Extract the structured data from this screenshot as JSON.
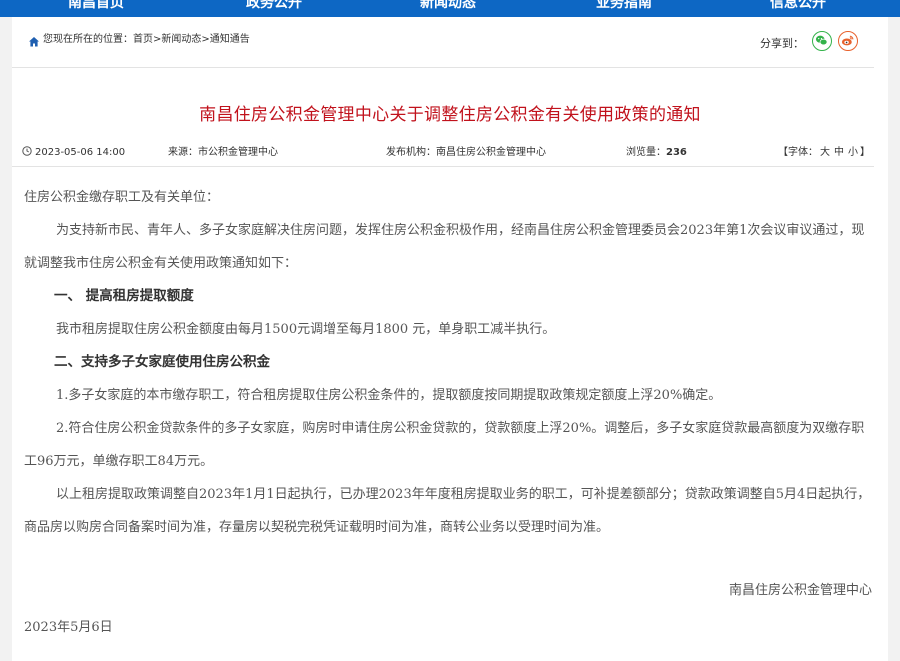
{
  "nav": {
    "items": [
      "南昌首页",
      "政务公开",
      "新闻动态",
      "业务指南",
      "信息公开"
    ]
  },
  "breadcrumb": {
    "prefix": "您现在所在的位置：",
    "home": "首页",
    "sep1": ">",
    "news": "新闻动态",
    "sep2": ">",
    "current": "通知通告"
  },
  "share": {
    "label": "分享到："
  },
  "article": {
    "title": "南昌住房公积金管理中心关于调整住房公积金有关使用政策的通知",
    "datetime": "2023-05-06 14:00",
    "source_label": "来源：",
    "source": "市公积金管理中心",
    "publisher_label": "发布机构：",
    "publisher": "南昌住房公积金管理中心",
    "views_label": "浏览量：",
    "views": "236",
    "fontsize_open": "【字体：",
    "fontsize_large": "大",
    "fontsize_medium": "中",
    "fontsize_small": "小",
    "fontsize_close": "】",
    "salutation": "住房公积金缴存职工及有关单位：",
    "intro": "为支持新市民、青年人、多子女家庭解决住房问题，发挥住房公积金积极作用，经南昌住房公积金管理委员会2023年第1次会议审议通过，现就调整我市住房公积金有关使用政策通知如下：",
    "heading1": "一、  提高租房提取额度",
    "para1": "我市租房提取住房公积金额度由每月1500元调增至每月1800  元，单身职工减半执行。",
    "heading2": "二、支持多子女家庭使用住房公积金",
    "item1": "1.多子女家庭的本市缴存职工，符合租房提取住房公积金条件的，提取额度按同期提取政策规定额度上浮20%确定。",
    "item2": "2.符合住房公积金贷款条件的多子女家庭，购房时申请住房公积金贷款的，贷款额度上浮20%。调整后，多子女家庭贷款最高额度为双缴存职工96万元，单缴存职工84万元。",
    "para_final": "以上租房提取政策调整自2023年1月1日起执行，已办理2023年年度租房提取业务的职工，可补提差额部分；贷款政策调整自5月4日起执行，商品房以购房合同备案时间为准，存量房以契税完税凭证载明时间为准，商转公业务以受理时间为准。",
    "signature": "南昌住房公积金管理中心",
    "date": "2023年5月6日"
  },
  "colors": {
    "nav_bg": "#0d67c4",
    "title_red": "#c1121c",
    "wechat_green": "#33b24a",
    "weibo_orange": "#e8612c"
  },
  "icons": [
    "home-icon",
    "clock-icon",
    "wechat-icon",
    "weibo-icon"
  ]
}
